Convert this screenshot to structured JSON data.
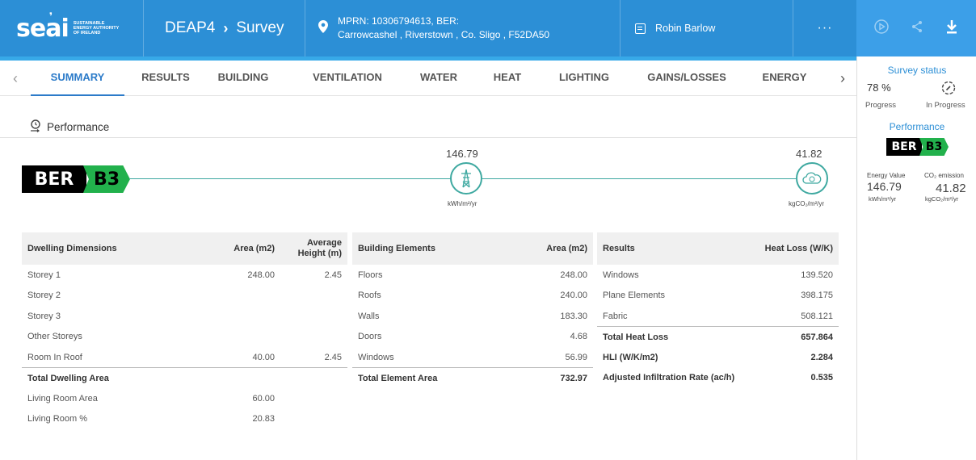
{
  "header": {
    "logo_text": "seai",
    "logo_subtext": [
      "Sustainable",
      "Energy Authority",
      "of Ireland"
    ],
    "app_name": "DEAP4",
    "breadcrumb_sep": "›",
    "section": "Survey",
    "mprn_line1": "MPRN: 10306794613, BER:",
    "mprn_line2": "Carrowcashel , Riverstown , Co. Sligo , F52DA50",
    "user_name": "Robin Barlow",
    "more": "···"
  },
  "tabs": [
    "SUMMARY",
    "RESULTS",
    "BUILDING",
    "VENTILATION",
    "WATER",
    "HEAT",
    "LIGHTING",
    "GAINS/LOSSES",
    "ENERGY"
  ],
  "active_tab": "SUMMARY",
  "performance": {
    "title": "Performance",
    "ber_prefix": "BER",
    "ber_rating": "B3",
    "energy_value": "146.79",
    "energy_unit": "kWh/m²/yr",
    "co2_value": "41.82",
    "co2_unit": "kgCO₂/m²/yr"
  },
  "dwelling": {
    "headers": [
      "Dwelling Dimensions",
      "Area (m2)",
      "Average Height (m)"
    ],
    "rows": [
      [
        "Storey 1",
        "248.00",
        "2.45"
      ],
      [
        "Storey 2",
        "",
        ""
      ],
      [
        "Storey 3",
        "",
        ""
      ],
      [
        "Other Storeys",
        "",
        ""
      ],
      [
        "Room In Roof",
        "40.00",
        "2.45"
      ]
    ],
    "total_label": "Total Dwelling Area",
    "total_value": "",
    "living_area_label": "Living Room Area",
    "living_area_value": "60.00",
    "living_pct_label": "Living Room %",
    "living_pct_value": "20.83"
  },
  "elements": {
    "headers": [
      "Building Elements",
      "Area (m2)"
    ],
    "rows": [
      [
        "Floors",
        "248.00"
      ],
      [
        "Roofs",
        "240.00"
      ],
      [
        "Walls",
        "183.30"
      ],
      [
        "Doors",
        "4.68"
      ],
      [
        "Windows",
        "56.99"
      ]
    ],
    "total_label": "Total Element Area",
    "total_value": "732.97"
  },
  "results": {
    "headers": [
      "Results",
      "Heat Loss (W/K)"
    ],
    "rows": [
      [
        "Windows",
        "139.520"
      ],
      [
        "Plane Elements",
        "398.175"
      ],
      [
        "Fabric",
        "508.121"
      ]
    ],
    "bold_rows": [
      [
        "Total Heat Loss",
        "657.864"
      ],
      [
        "HLI (W/K/m2)",
        "2.284"
      ],
      [
        "Adjusted Infiltration Rate (ac/h)",
        "0.535"
      ]
    ]
  },
  "sidebar": {
    "status_title": "Survey status",
    "progress_value": "78 %",
    "progress_label": "Progress",
    "status_label": "In Progress",
    "performance_title": "Performance",
    "energy_label": "Energy Value",
    "energy_value": "146.79",
    "energy_unit": "kWh/m²/yr",
    "co2_label": "CO₂ emission",
    "co2_value": "41.82",
    "co2_unit": "kgCO₂/m²/yr"
  },
  "colors": {
    "header_bg": "#2c8fd6",
    "accent": "#2c7bc9",
    "ber_green": "#22b14c",
    "teal": "#3fa9a1"
  }
}
